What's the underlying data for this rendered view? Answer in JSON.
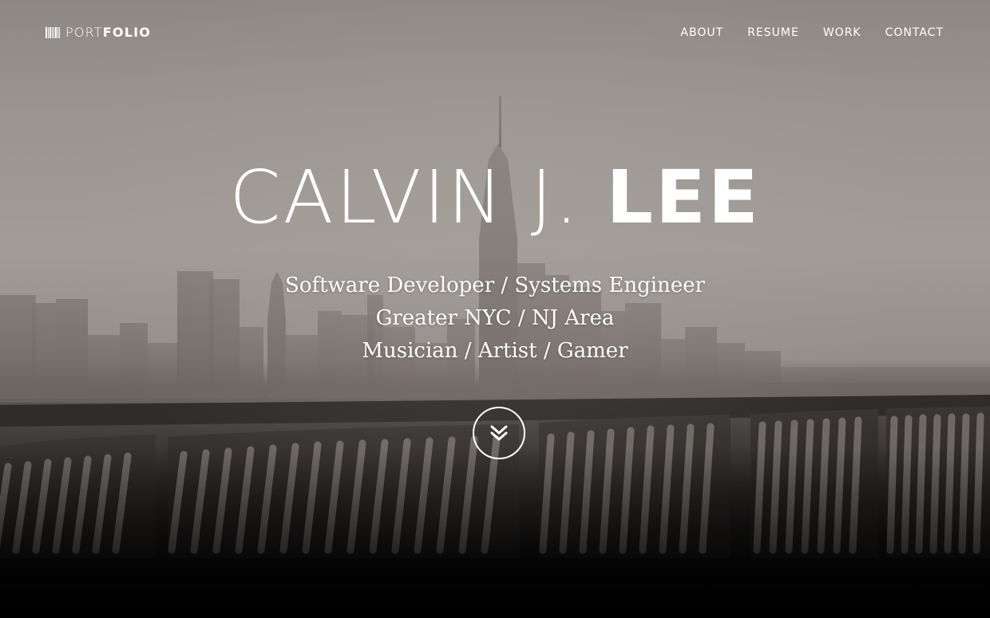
{
  "header": {
    "logo_light": "PORT",
    "logo_bold": "FOLIO",
    "logo_icon": "barcode-icon",
    "nav": [
      {
        "label": "ABOUT"
      },
      {
        "label": "RESUME"
      },
      {
        "label": "WORK"
      },
      {
        "label": "CONTACT"
      }
    ]
  },
  "hero": {
    "name_first": "CALVIN J.",
    "name_last": "LEE",
    "taglines": [
      "Software Developer / Systems Engineer",
      "Greater NYC / NJ Area",
      "Musician / Artist / Gamer"
    ],
    "scroll_icon": "double-chevron-down-icon"
  },
  "colors": {
    "text": "#ffffff",
    "background_top": "#9a9591",
    "background_bottom": "#050505"
  }
}
